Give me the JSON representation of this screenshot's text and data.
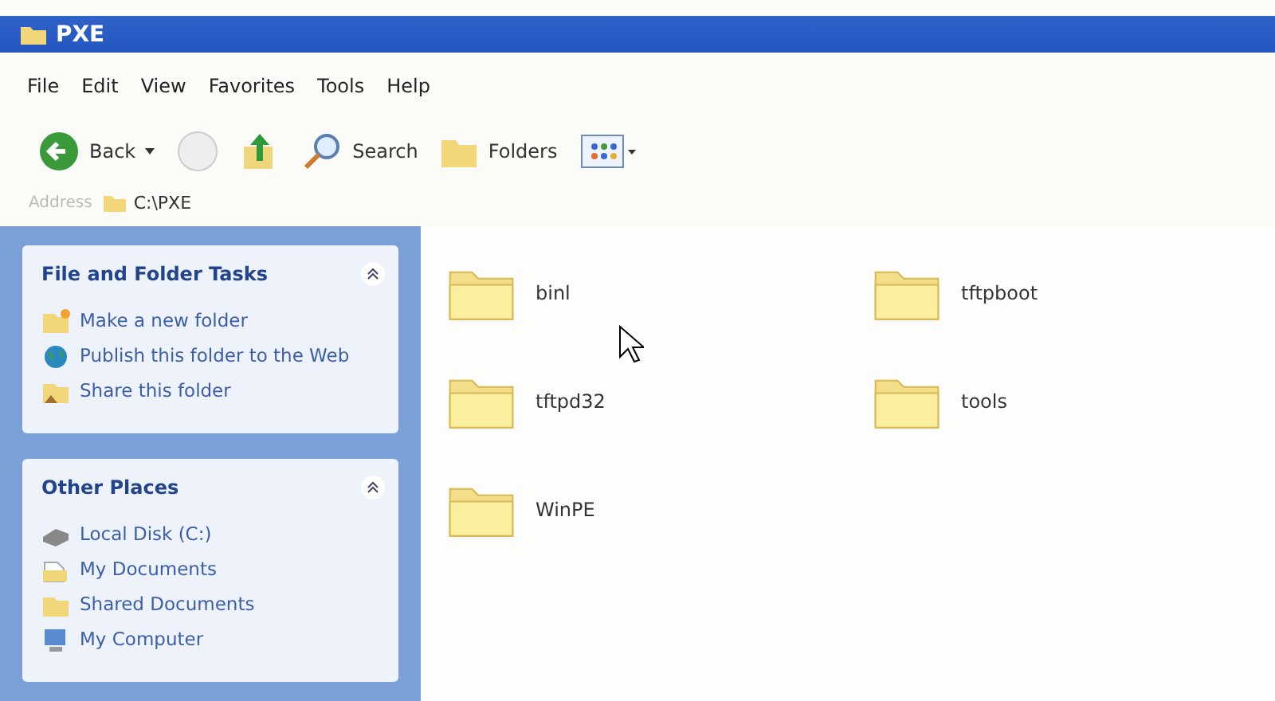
{
  "window": {
    "title": "PXE"
  },
  "menu": [
    "File",
    "Edit",
    "View",
    "Favorites",
    "Tools",
    "Help"
  ],
  "toolbar": [
    {
      "kind": "back",
      "label": "Back"
    },
    {
      "kind": "forward"
    },
    {
      "kind": "up"
    },
    {
      "kind": "search",
      "label": "Search"
    },
    {
      "kind": "folders",
      "label": "Folders"
    },
    {
      "kind": "views"
    }
  ],
  "address": {
    "label": "Address",
    "value": "C:\\PXE"
  },
  "panels": [
    {
      "title": "File and Folder Tasks",
      "items": [
        {
          "kind": "newfolder",
          "label": "Make a new folder"
        },
        {
          "kind": "web",
          "label": "Publish this folder to the Web"
        },
        {
          "kind": "share",
          "label": "Share this folder"
        }
      ]
    },
    {
      "title": "Other Places",
      "items": [
        {
          "kind": "disk",
          "label": "Local Disk (C:)"
        },
        {
          "kind": "docs",
          "label": "My Documents"
        },
        {
          "kind": "shared",
          "label": "Shared Documents"
        },
        {
          "kind": "computer",
          "label": "My Computer"
        }
      ]
    }
  ],
  "folders": [
    "binl",
    "tftpboot",
    "tftpd32",
    "tools",
    "WinPE"
  ]
}
